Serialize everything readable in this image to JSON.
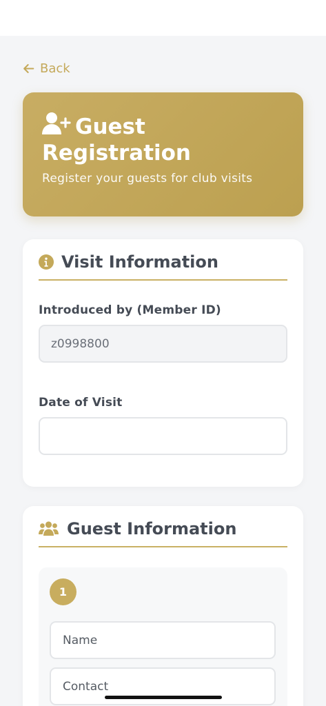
{
  "nav": {
    "back_label": "Back"
  },
  "hero": {
    "title": "Guest Registration",
    "subtitle": "Register your guests for club visits",
    "icon": "user-plus-icon"
  },
  "visit_section": {
    "title": "Visit Information",
    "icon": "info-circle-icon",
    "introducer_label": "Introduced by (Member ID)",
    "introducer_value": "z0998800",
    "date_label": "Date of Visit",
    "date_value": ""
  },
  "guest_section": {
    "title": "Guest Information",
    "icon": "users-icon",
    "guest_number": "1",
    "name_placeholder": "Name",
    "contact_placeholder": "Contact"
  },
  "colors": {
    "accent": "#c4a95a",
    "heading": "#454b55",
    "background": "#f4f5f7"
  }
}
